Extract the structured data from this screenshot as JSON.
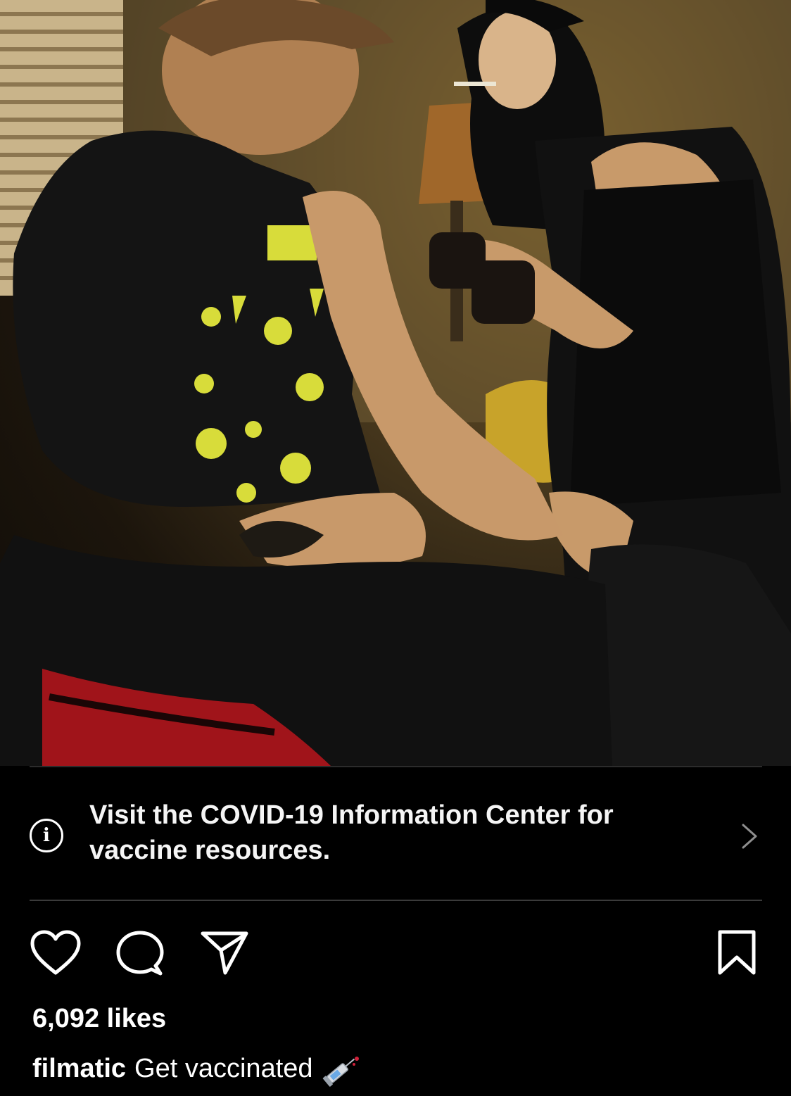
{
  "post": {
    "image_alt": "",
    "covid_banner": {
      "text": "Visit the COVID-19 Information Center for vaccine resources.",
      "icon": "info-icon",
      "chevron_icon": "chevron-right-icon"
    },
    "actions": {
      "like_icon": "heart-icon",
      "comment_icon": "comment-icon",
      "share_icon": "paper-plane-icon",
      "save_icon": "bookmark-icon"
    },
    "likes_text": "6,092 likes",
    "caption": {
      "username": "filmatic",
      "text": "Get vaccinated",
      "emoji_icon": "syringe-icon"
    }
  },
  "colors": {
    "background": "#000000",
    "divider": "#2c2c2c",
    "text": "#ffffff"
  }
}
